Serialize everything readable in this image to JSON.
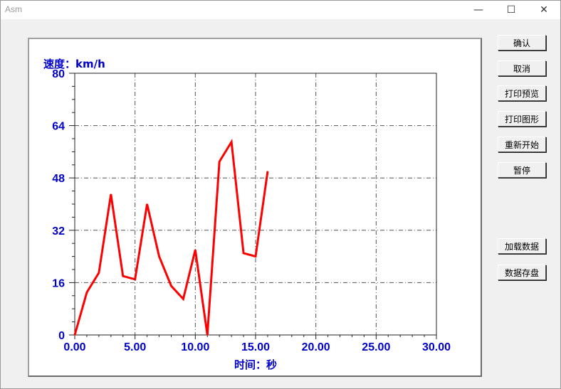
{
  "window": {
    "title": "Asm"
  },
  "titlebar": {
    "min_glyph": "—",
    "max_glyph": "☐",
    "close_glyph": "✕"
  },
  "buttons": [
    {
      "label": "确认"
    },
    {
      "label": "取消"
    },
    {
      "label": "打印预览"
    },
    {
      "label": "打印图形"
    },
    {
      "label": "重新开始"
    },
    {
      "label": "暂停"
    },
    {
      "label": "加载数据"
    },
    {
      "label": "数据存盘"
    }
  ],
  "chart_data": {
    "type": "line",
    "ylabel": "速度：km/h",
    "xlabel": "时间：秒",
    "xlim": [
      0,
      30
    ],
    "ylim": [
      0,
      80
    ],
    "x_ticks": [
      "0.00",
      "5.00",
      "10.00",
      "15.00",
      "20.00",
      "25.00",
      "30.00"
    ],
    "y_ticks": [
      "0",
      "16",
      "32",
      "48",
      "64",
      "80"
    ],
    "grid": true,
    "colors": {
      "line": "#ff0000",
      "axis_text": "#0000cc",
      "grid": "#555555"
    },
    "series": [
      {
        "x": [
          0,
          1,
          2,
          3,
          4,
          5,
          6,
          7,
          8,
          9,
          10,
          11,
          12,
          13,
          14,
          15,
          16
        ],
        "values": [
          0,
          13,
          19,
          43,
          18,
          17,
          40,
          24,
          15,
          11,
          26,
          0,
          53,
          59,
          25,
          24,
          50
        ]
      }
    ]
  }
}
